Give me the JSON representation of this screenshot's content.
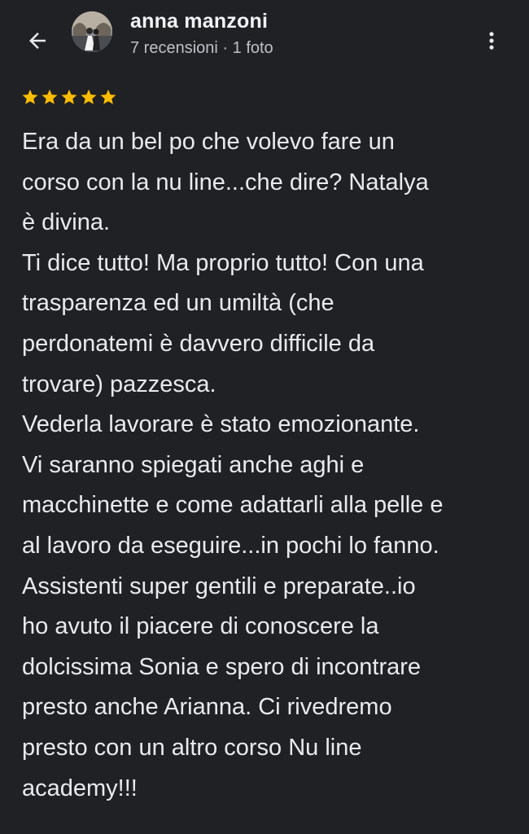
{
  "header": {
    "back_icon": "arrow-back-icon",
    "reviewer_name": "anna manzoni",
    "reviews_count": "7 recensioni",
    "separator": "·",
    "photos_count": "1 foto",
    "more_icon": "more-vert-icon"
  },
  "rating": {
    "stars": 5,
    "max": 5,
    "color": "#fbbc04"
  },
  "review": {
    "lines": [
      "Era da un bel po che volevo fare un",
      "corso con la nu line...che dire? Natalya",
      "è divina.",
      "Ti dice tutto! Ma proprio tutto! Con una",
      "trasparenza ed un umiltà (che",
      "perdonatemi è davvero difficile da",
      "trovare) pazzesca.",
      "Vederla lavorare è stato emozionante.",
      "Vi saranno spiegati anche aghi e",
      "macchinette e come adattarli alla pelle e",
      "al lavoro da eseguire...in pochi lo fanno.",
      "Assistenti super gentili e preparate..io",
      "ho avuto il piacere di conoscere la",
      "dolcissima Sonia e spero di incontrare",
      "presto anche Arianna. Ci rivedremo",
      "presto con un altro corso Nu line",
      "academy!!!"
    ]
  },
  "colors": {
    "background": "#202124",
    "text": "#e8eaed",
    "secondary_text": "#bdc1c6",
    "star": "#fbbc04"
  }
}
